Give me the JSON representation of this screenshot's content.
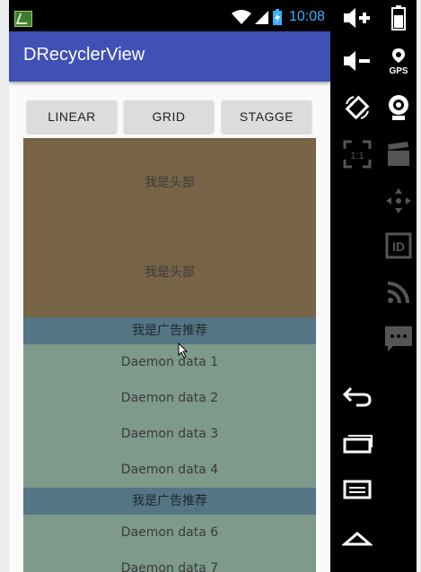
{
  "status_bar": {
    "time": "10:08",
    "icons": [
      "app-notification-icon",
      "wifi-icon",
      "signal-icon",
      "battery-charging-icon"
    ]
  },
  "app_bar": {
    "title": "DRecyclerView"
  },
  "buttons": {
    "linear": "LINEAR",
    "grid": "GRID",
    "stagger": "STAGGE"
  },
  "list": {
    "headers": [
      "我是头部",
      "我是头部"
    ],
    "ad_label": "我是广告推荐",
    "items": [
      "Daemon data 1",
      "Daemon data 2",
      "Daemon data 3",
      "Daemon data 4",
      "Daemon data 6",
      "Daemon data 7"
    ]
  },
  "emulator_controls": [
    "volume-up-icon",
    "battery-icon",
    "volume-down-icon",
    "gps-icon",
    "rotate-icon",
    "camera-icon",
    "fullscreen-icon",
    "video-icon",
    "dpad-icon",
    "id-icon",
    "rss-icon",
    "sms-icon",
    "back-icon",
    "recents-icon",
    "menu-icon",
    "home-icon"
  ],
  "colors": {
    "app_bar": "#3f51b5",
    "header_bg": "#786447",
    "ad_bg": "#547583",
    "item_bg": "#7d9a8b",
    "status_accent": "#39b0ff"
  }
}
